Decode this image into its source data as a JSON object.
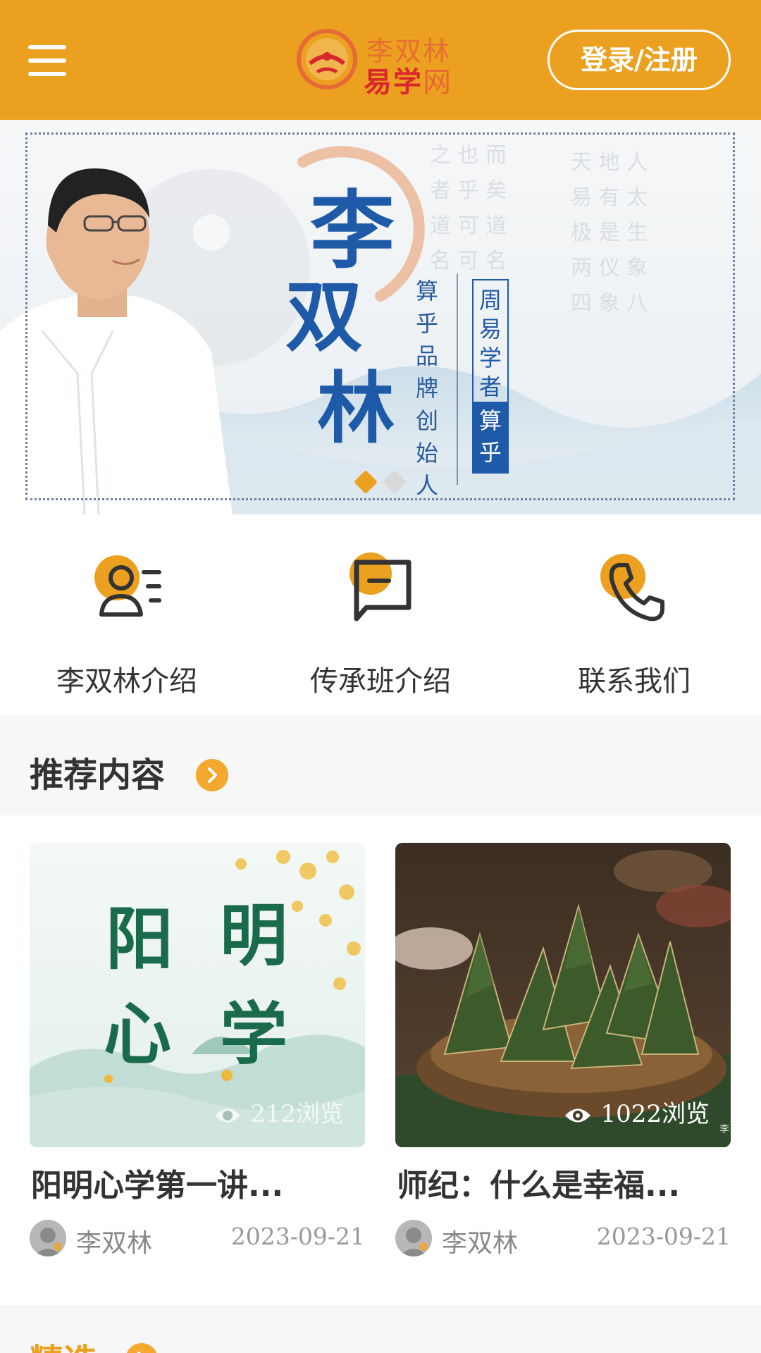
{
  "header": {
    "logo_line1": "李双林",
    "logo_line2a": "易学",
    "logo_line2b": "网",
    "login_label": "登录/注册"
  },
  "banner": {
    "name_chars": [
      "李",
      "双",
      "林"
    ],
    "subtitle_chars": [
      "算",
      "乎",
      "品",
      "牌",
      "创",
      "始",
      "人"
    ],
    "tag_top": "周易学者",
    "tag_bottom": "算乎",
    "slide_count": 2,
    "active_slide": 1
  },
  "quick_nav": [
    {
      "label": "李双林介绍",
      "icon": "person-card-icon"
    },
    {
      "label": "传承班介绍",
      "icon": "chat-box-icon"
    },
    {
      "label": "联系我们",
      "icon": "phone-icon"
    }
  ],
  "recommended": {
    "title": "推荐内容",
    "cards": [
      {
        "image_text": [
          "阳",
          "明",
          "心",
          "学"
        ],
        "views": "212浏览",
        "title": "阳明心学第一讲...",
        "author": "李双林",
        "date": "2023-09-21"
      },
      {
        "views": "1022浏览",
        "watermark": "李",
        "title": "师纪：什么是幸福...",
        "author": "李双林",
        "date": "2023-09-21"
      }
    ]
  },
  "featured": {
    "title": "精选"
  },
  "colors": {
    "header_bg": "#eba01f",
    "accent": "#f2a92e",
    "banner_blue": "#1e5aa8"
  }
}
